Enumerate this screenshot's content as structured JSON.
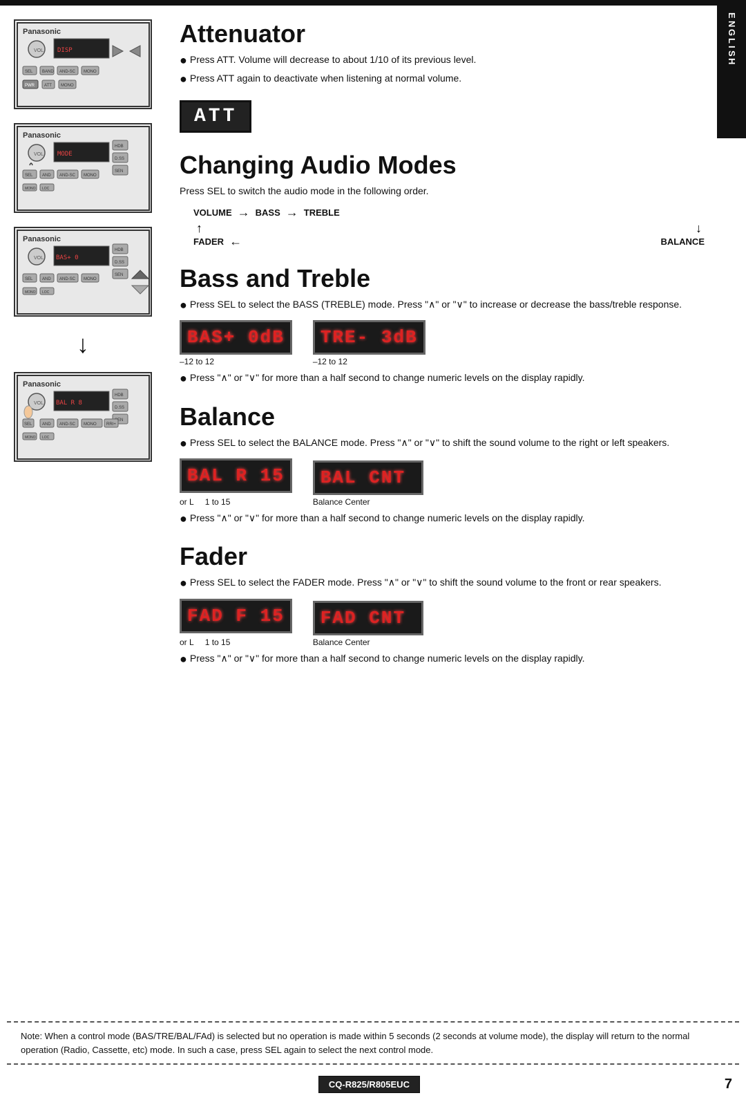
{
  "page": {
    "top_bar_color": "#111",
    "side_tab": {
      "letters": [
        "E",
        "N",
        "G",
        "L",
        "I",
        "S",
        "H"
      ]
    },
    "page_number": "7",
    "model_badge": "CQ-R825/R805EUC"
  },
  "attenuator": {
    "title": "Attenuator",
    "bullet1": "Press ATT. Volume will decrease to about 1/10 of its previous level.",
    "bullet2": "Press ATT again to deactivate when listening at normal volume.",
    "display": "ATT"
  },
  "changing_audio_modes": {
    "title": "Changing Audio Modes",
    "intro": "Press SEL to switch the audio mode in the following order.",
    "flow": {
      "volume": "VOLUME",
      "bass": "BASS",
      "treble": "TREBLE",
      "fader": "FADER",
      "balance": "BALANCE"
    }
  },
  "bass_treble": {
    "title": "Bass and Treble",
    "bullet1": "Press SEL to select the BASS (TREBLE) mode. Press \"/\\\" or \"\\/\" to increase or decrease the bass/treble response.",
    "display1_text": "BAS+ 0dB",
    "display2_text": "TRE- 3dB",
    "caption1": "–12 to 12",
    "caption2": "–12 to 12",
    "bullet2": "Press \"/\\\" or \"\\/\" for more than a half second to change numeric levels on the display rapidly."
  },
  "balance": {
    "title": "Balance",
    "bullet1": "Press SEL to select the BALANCE mode. Press \"/\\\" or \"\\/\" to shift the sound volume to the right or left speakers.",
    "display1_text": "BAL R 15",
    "display2_text": "BAL CNT",
    "caption1_orl": "or L",
    "caption1_range": "1 to 15",
    "caption2": "Balance Center",
    "bullet2": "Press \"/\\\" or \"\\/\" for more than a half second to change numeric levels on the display rapidly."
  },
  "fader": {
    "title": "Fader",
    "bullet1": "Press SEL to select the FADER mode. Press \"/\\\" or \"\\/\" to shift the sound volume to the front or rear speakers.",
    "display1_text": "FAD F 15",
    "display2_text": "FAD CNT",
    "caption1_orl": "or L",
    "caption1_range": "1 to 15",
    "caption2": "Balance Center",
    "bullet2": "Press \"/\\\" or \"\\/\" for more than a half second to change numeric levels on the display rapidly."
  },
  "note": {
    "text": "Note: When a control mode (BAS/TRE/BAL/FAd) is selected but no operation is made within 5 seconds (2 seconds at volume mode), the display will return to the normal operation (Radio, Cassette, etc) mode. In such a case, press SEL again to select the next control mode."
  },
  "icons": {
    "bullet_dot": "●",
    "right_arrow": "→",
    "left_arrow": "←",
    "down_arrow": "↓",
    "up_arrow": "↑"
  }
}
